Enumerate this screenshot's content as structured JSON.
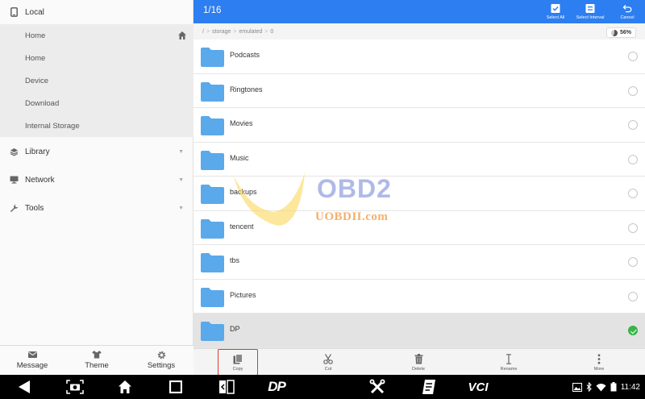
{
  "sidebar": {
    "sections": [
      {
        "label": "Local",
        "icon": "phone-icon"
      },
      {
        "label": "Library",
        "icon": "layers-icon"
      },
      {
        "label": "Network",
        "icon": "network-icon"
      },
      {
        "label": "Tools",
        "icon": "wrench-icon"
      }
    ],
    "local_items": [
      {
        "label": "Home"
      },
      {
        "label": "Home"
      },
      {
        "label": "Device"
      },
      {
        "label": "Download"
      },
      {
        "label": "Internal Storage"
      }
    ],
    "bottom": [
      {
        "label": "Message",
        "icon": "mail-icon"
      },
      {
        "label": "Theme",
        "icon": "shirt-icon"
      },
      {
        "label": "Settings",
        "icon": "gear-icon"
      }
    ]
  },
  "header": {
    "count": "1/16",
    "select_all": "Select All",
    "select_interval": "Select Interval",
    "cancel": "Cancel"
  },
  "path": {
    "crumbs": [
      "/",
      ">",
      "storage",
      ">",
      "emulated",
      ">",
      "0"
    ],
    "storage_percent": "56%",
    "storage_used_fraction": 0.56
  },
  "files": [
    {
      "name": "Podcasts",
      "selected": false
    },
    {
      "name": "Ringtones",
      "selected": false
    },
    {
      "name": "Movies",
      "selected": false
    },
    {
      "name": "Music",
      "selected": false
    },
    {
      "name": "backups",
      "selected": false
    },
    {
      "name": "tencent",
      "selected": false
    },
    {
      "name": "tbs",
      "selected": false
    },
    {
      "name": "Pictures",
      "selected": false
    },
    {
      "name": "DP",
      "selected": true
    }
  ],
  "actions": {
    "copy": "Copy",
    "cut": "Cut",
    "delete": "Delete",
    "rename": "Rename",
    "more": "More"
  },
  "watermark": {
    "brand": "OBD2",
    "url": "UOBDII.com"
  },
  "navbar": {
    "dp_label": "DP",
    "vci_label": "VCI",
    "time": "11:42"
  },
  "colors": {
    "accent": "#2d7ef0",
    "folder": "#5aa9ea",
    "selected_check": "#39b34a",
    "highlight_box": "#e03a2f"
  }
}
